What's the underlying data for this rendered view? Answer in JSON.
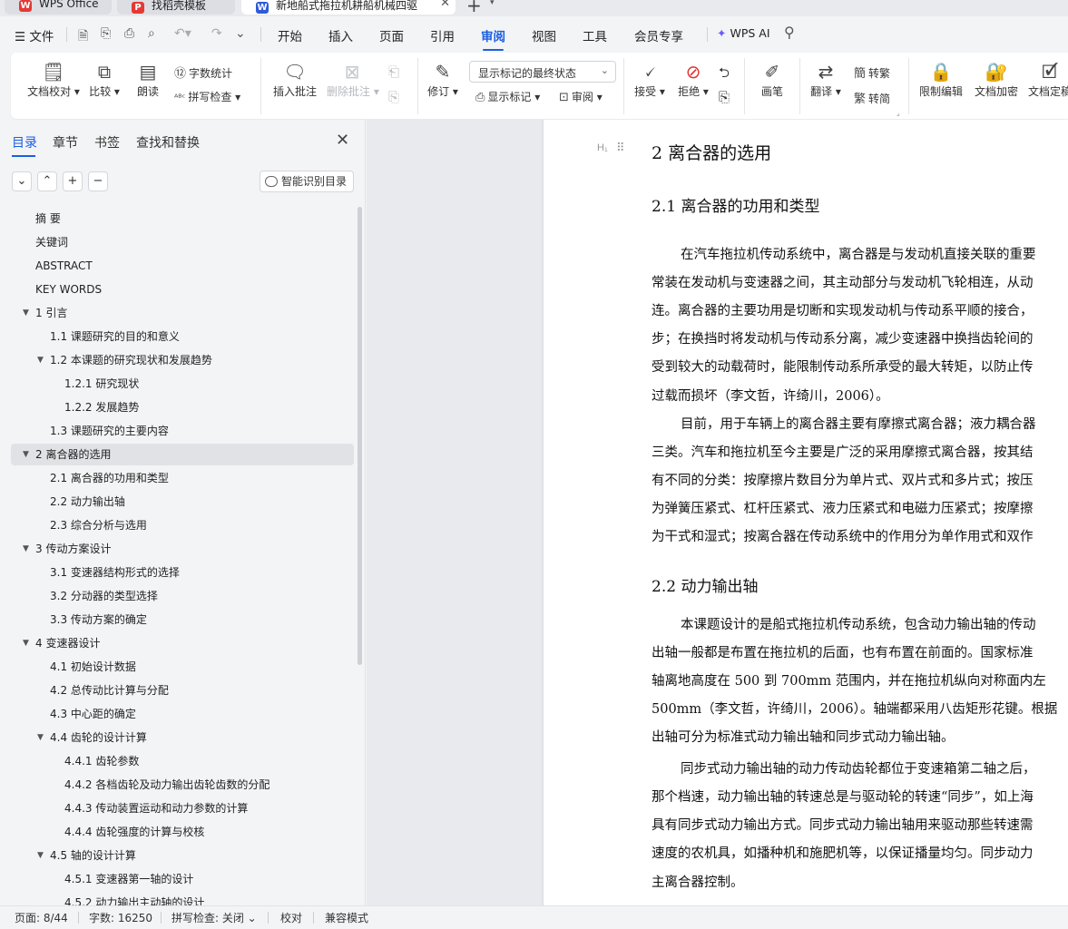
{
  "tabs": [
    {
      "label": "WPS Office",
      "logo": "W",
      "color": "#e53935"
    },
    {
      "label": "找稻壳模板",
      "logo": "P",
      "color": "#e53935"
    },
    {
      "label": "新地船式拖拉机耕船机械四驱",
      "logo": "W",
      "color": "#2f5bd8"
    }
  ],
  "menu": {
    "file": "文件",
    "items": [
      "开始",
      "插入",
      "页面",
      "引用",
      "审阅",
      "视图",
      "工具",
      "会员专享"
    ],
    "ai": "WPS AI"
  },
  "ribbon": {
    "doc_check": "文档校对",
    "compare": "比较",
    "read_aloud": "朗读",
    "word_count": "字数统计",
    "spell_check": "拼写检查",
    "insert_comment": "插入批注",
    "delete_comment": "删除批注",
    "revise": "修订",
    "display_mode": "显示标记的最终状态",
    "show_markup": "显示标记",
    "review": "审阅",
    "accept": "接受",
    "reject": "拒绝",
    "pen": "画笔",
    "translate": "翻译",
    "trad": "繁转简",
    "trad_label": "转繁",
    "simp_label": "转简",
    "restrict": "限制编辑",
    "encrypt": "文档加密",
    "finalize": "文档定稿"
  },
  "sidebar": {
    "tabs": [
      "目录",
      "章节",
      "书签",
      "查找和替换"
    ],
    "smart_btn": "智能识别目录",
    "toc": [
      {
        "label": "摘 要",
        "level": 0,
        "caret": ""
      },
      {
        "label": "关键词",
        "level": 0,
        "caret": ""
      },
      {
        "label": "ABSTRACT",
        "level": 0,
        "caret": ""
      },
      {
        "label": "KEY WORDS",
        "level": 0,
        "caret": ""
      },
      {
        "label": "1 引言",
        "level": 0,
        "caret": "▼"
      },
      {
        "label": "1.1 课题研究的目的和意义",
        "level": 1,
        "caret": ""
      },
      {
        "label": "1.2 本课题的研究现状和发展趋势",
        "level": 1,
        "caret": "▼"
      },
      {
        "label": "1.2.1 研究现状",
        "level": 2,
        "caret": ""
      },
      {
        "label": "1.2.2 发展趋势",
        "level": 2,
        "caret": ""
      },
      {
        "label": "1.3 课题研究的主要内容",
        "level": 1,
        "caret": ""
      },
      {
        "label": "2 离合器的选用",
        "level": 0,
        "caret": "▼",
        "selected": true
      },
      {
        "label": "2.1 离合器的功用和类型",
        "level": 1,
        "caret": ""
      },
      {
        "label": "2.2 动力输出轴",
        "level": 1,
        "caret": ""
      },
      {
        "label": "2.3 综合分析与选用",
        "level": 1,
        "caret": ""
      },
      {
        "label": "3  传动方案设计",
        "level": 0,
        "caret": "▼"
      },
      {
        "label": "3.1  变速器结构形式的选择",
        "level": 1,
        "caret": ""
      },
      {
        "label": "3.2  分动器的类型选择",
        "level": 1,
        "caret": ""
      },
      {
        "label": "3.3  传动方案的确定",
        "level": 1,
        "caret": ""
      },
      {
        "label": "4  变速器设计",
        "level": 0,
        "caret": "▼"
      },
      {
        "label": "4.1  初始设计数据",
        "level": 1,
        "caret": ""
      },
      {
        "label": "4.2  总传动比计算与分配",
        "level": 1,
        "caret": ""
      },
      {
        "label": "4.3  中心距的确定",
        "level": 1,
        "caret": ""
      },
      {
        "label": "4.4  齿轮的设计计算",
        "level": 1,
        "caret": "▼"
      },
      {
        "label": "4.4.1  齿轮参数",
        "level": 2,
        "caret": ""
      },
      {
        "label": "4.4.2  各档齿轮及动力输出齿轮齿数的分配",
        "level": 2,
        "caret": ""
      },
      {
        "label": "4.4.3  传动装置运动和动力参数的计算",
        "level": 2,
        "caret": ""
      },
      {
        "label": "4.4.4  齿轮强度的计算与校核",
        "level": 2,
        "caret": ""
      },
      {
        "label": "4.5  轴的设计计算",
        "level": 1,
        "caret": "▼"
      },
      {
        "label": "4.5.1  变速器第一轴的设计",
        "level": 2,
        "caret": ""
      },
      {
        "label": "4.5.2  动力输出主动轴的设计",
        "level": 2,
        "caret": ""
      }
    ]
  },
  "document": {
    "heading1": "2 离合器的选用",
    "heading2a": "2.1 离合器的功用和类型",
    "heading2b": "2.2 动力输出轴",
    "lines": [
      "在汽车拖拉机传动系统中，离合器是与发动机直接关联的重要",
      "常装在发动机与变速器之间，其主动部分与发动机飞轮相连，从动",
      "连。离合器的主要功用是切断和实现发动机与传动系平顺的接合，",
      "步；在换挡时将发动机与传动系分离，减少变速器中换挡齿轮间的",
      "受到较大的动载荷时，能限制传动系所承受的最大转矩，以防止传",
      "过载而损坏（李文哲，许绮川，2006）。",
      "目前，用于车辆上的离合器主要有摩擦式离合器；液力耦合器",
      "三类。汽车和拖拉机至今主要是广泛的采用摩擦式离合器，按其结",
      "有不同的分类：按摩擦片数目分为单片式、双片式和多片式；按压",
      "为弹簧压紧式、杠杆压紧式、液力压紧式和电磁力压紧式；按摩擦",
      "为干式和湿式；按离合器在传动系统中的作用分为单作用式和双作",
      "本课题设计的是船式拖拉机传动系统，包含动力输出轴的传动",
      "出轴一般都是布置在拖拉机的后面，也有布置在前面的。国家标准",
      "轴离地高度在 500 到 700mm 范围内，并在拖拉机纵向对称面内左",
      "500mm（李文哲，许绮川，2006）。轴端都采用八齿矩形花键。根据",
      "出轴可分为标准式动力输出轴和同步式动力输出轴。",
      "同步式动力输出轴的动力传动齿轮都位于变速箱第二轴之后，",
      "那个档速，动力输出轴的转速总是与驱动轮的转速“同步”，如上海",
      "具有同步式动力输出方式。同步式动力输出轴用来驱动那些转速需",
      "速度的农机具，如播种机和施肥机等，以保证播量均匀。同步动力",
      "主离合器控制。"
    ]
  },
  "status": {
    "page": "页面: 8/44",
    "words": "字数: 16250",
    "spell": "拼写检查: 关闭",
    "proof": "校对",
    "compat": "兼容模式"
  }
}
